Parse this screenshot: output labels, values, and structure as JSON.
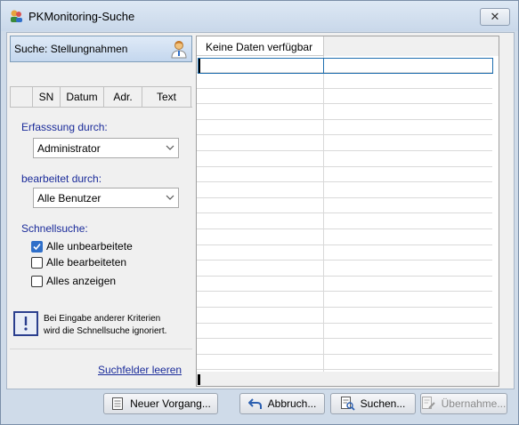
{
  "window": {
    "title": "PKMonitoring-Suche",
    "close_label": "✕"
  },
  "search_panel": {
    "title": "Suche: Stellungnahmen",
    "tabs": [
      {
        "label": "SN"
      },
      {
        "label": "Datum"
      },
      {
        "label": "Adr."
      },
      {
        "label": "Text"
      }
    ],
    "created_by": {
      "label": "Erfasssung durch:",
      "value": "Administrator"
    },
    "edited_by": {
      "label": "bearbeitet durch:",
      "value": "Alle Benutzer"
    },
    "quick_search": {
      "label": "Schnellsuche:",
      "options": [
        {
          "label": "Alle unbearbeitete",
          "checked": true
        },
        {
          "label": "Alle bearbeiteten",
          "checked": false
        },
        {
          "label": "Alles anzeigen",
          "checked": false
        }
      ]
    },
    "hint_line1": "Bei Eingabe anderer Kriterien",
    "hint_line2": "wird die Schnellsuche ignoriert.",
    "clear_link": "Suchfelder leeren"
  },
  "results_grid": {
    "header": "Keine Daten verfügbar"
  },
  "buttons": {
    "new": "Neuer Vorgang...",
    "cancel": "Abbruch...",
    "search": "Suchen...",
    "accept": "Übernahme..."
  },
  "colors": {
    "label_blue": "#1a2b9a",
    "accent": "#2f6fc9"
  }
}
